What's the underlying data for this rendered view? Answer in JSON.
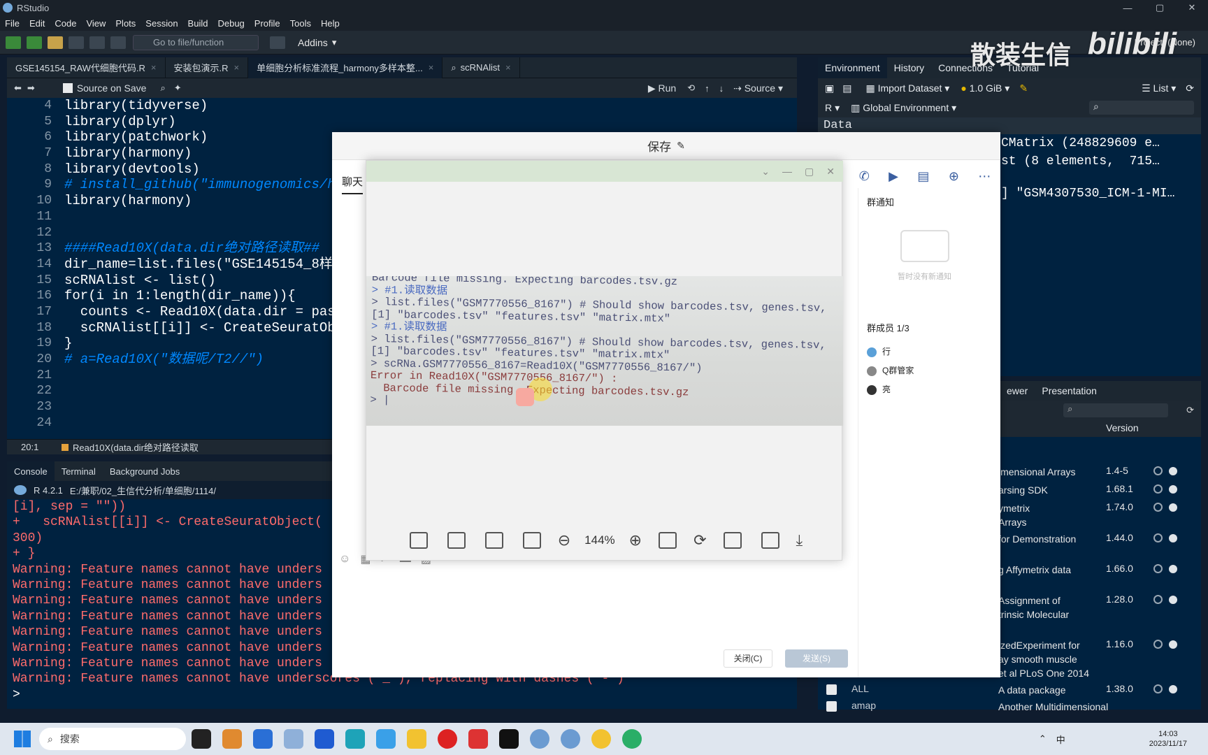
{
  "window": {
    "title": "RStudio"
  },
  "menu": [
    "File",
    "Edit",
    "Code",
    "View",
    "Plots",
    "Session",
    "Build",
    "Debug",
    "Profile",
    "Tools",
    "Help"
  ],
  "toolbar": {
    "goto_placeholder": "Go to file/function",
    "addins": "Addins",
    "project": "Project: (None)"
  },
  "editor": {
    "tabs": [
      {
        "label": "GSE145154_RAW代细胞代码.R",
        "active": false
      },
      {
        "label": "安装包演示.R",
        "active": false
      },
      {
        "label": "单细胞分析标准流程_harmony多样本整...",
        "active": true
      },
      {
        "label": "scRNAlist",
        "active": false
      }
    ],
    "source_on_save": "Source on Save",
    "run": "Run",
    "source": "Source",
    "line_numbers": [
      "4",
      "5",
      "6",
      "7",
      "8",
      "9",
      "10",
      "11",
      "12",
      "13",
      "14",
      "15",
      "16",
      "17",
      "18",
      "19",
      "20",
      "21",
      "22",
      "23",
      "24"
    ],
    "lines": [
      "library(tidyverse)",
      "library(dplyr)",
      "library(patchwork)",
      "library(harmony)",
      "library(devtools)",
      "# install_github(\"immunogenomics/h",
      "library(harmony)",
      "",
      "",
      "####Read10X(data.dir绝对路径读取##",
      "dir_name=list.files(\"GSE145154_8样",
      "scRNAlist <- list()",
      "for(i in 1:length(dir_name)){",
      "  counts <- Read10X(data.dir = pas",
      "  scRNAlist[[i]] <- CreateSeuratOb",
      "}",
      "# a=Read10X(\"数据呢/T2//\")",
      "",
      "",
      "",
      ""
    ],
    "status_position": "20:1",
    "status_scope": "Read10X(data.dir绝对路径读取"
  },
  "console": {
    "tabs": [
      "Console",
      "Terminal",
      "Background Jobs"
    ],
    "r_version": "R 4.2.1",
    "path": "E:/兼职/02_生信代分析/单细胞/1114/",
    "lines": [
      "[i], sep = \"\"))",
      "+   scRNAlist[[i]] <- CreateSeuratObject(",
      "300)",
      "+ }",
      "Warning: Feature names cannot have unders",
      "Warning: Feature names cannot have unders",
      "Warning: Feature names cannot have unders",
      "Warning: Feature names cannot have unders",
      "Warning: Feature names cannot have unders",
      "Warning: Feature names cannot have unders",
      "Warning: Feature names cannot have unders",
      "Warning: Feature names cannot have underscores ('_'), replacing with dashes ('-')",
      ">"
    ]
  },
  "environment": {
    "tabs": [
      "Environment",
      "History",
      "Connections",
      "Tutorial"
    ],
    "import_dataset": "Import Dataset",
    "memory": "1.0 GiB",
    "list_mode": "List",
    "lang": "R",
    "scope": "Global Environment",
    "section": "Data",
    "rows": [
      "CMatrix (248829609 e…",
      "st (8 elements,  715…",
      "] \"GSM4307530_ICM-1-MI…"
    ]
  },
  "packages": {
    "tabs": [
      "ewer",
      "Presentation"
    ],
    "version_header": "Version",
    "rows": [
      {
        "desc": "imensional Arrays",
        "version": "1.4-5"
      },
      {
        "desc": "arsing SDK",
        "version": "1.68.1"
      },
      {
        "desc": "ymetrix\nArrays",
        "version": "1.74.0"
      },
      {
        "desc": "for Demonstration",
        "version": "1.44.0"
      },
      {
        "desc": "g Affymetrix data",
        "version": "1.66.0"
      },
      {
        "desc": "Assignment of\ntrinsic Molecular",
        "version": "1.28.0"
      },
      {
        "desc": "izedExperiment for\nay smooth muscle\net al PLoS One 2014",
        "version": "1.16.0"
      },
      {
        "name": "ALL",
        "desc": "A data package",
        "version": "1.38.0"
      },
      {
        "name": "amap",
        "desc": "Another Multidimensional",
        "version": ""
      }
    ]
  },
  "qq": {
    "title": "保存",
    "chat_tab": "聊天",
    "notice_title": "群通知",
    "notice_empty": "暂时没有新通知",
    "members_title": "群成员 1/3",
    "members": [
      "行",
      "Q群管家",
      "亮"
    ],
    "bottom_btn1": "关闭(C)",
    "bottom_btn2": "发送(S)"
  },
  "viewer": {
    "zoom": "144%",
    "screenshot_lines": [
      "Barcode file missing. Expecting barcodes.tsv.gz",
      "> #1.读取数据",
      "> list.files(\"GSM7770556_8167\") # Should show barcodes.tsv, genes.tsv,",
      "[1] \"barcodes.tsv\" \"features.tsv\" \"matrix.mtx\"",
      "> #1.读取数据",
      "> list.files(\"GSM7770556_8167\") # Should show barcodes.tsv, genes.tsv,",
      "[1] \"barcodes.tsv\" \"features.tsv\" \"matrix.mtx\"",
      "> scRNa.GSM7770556_8167=Read10X(\"GSM7770556_8167/\")",
      "Error in Read10X(\"GSM7770556_8167/\") :",
      "  Barcode file missing. Expecting barcodes.tsv.gz",
      "> |"
    ]
  },
  "watermark": {
    "text": "散装生信",
    "logo": "bilibili"
  },
  "taskbar": {
    "search": "搜索",
    "time": "14:03",
    "date": "2023/11/17",
    "ime": "中"
  }
}
